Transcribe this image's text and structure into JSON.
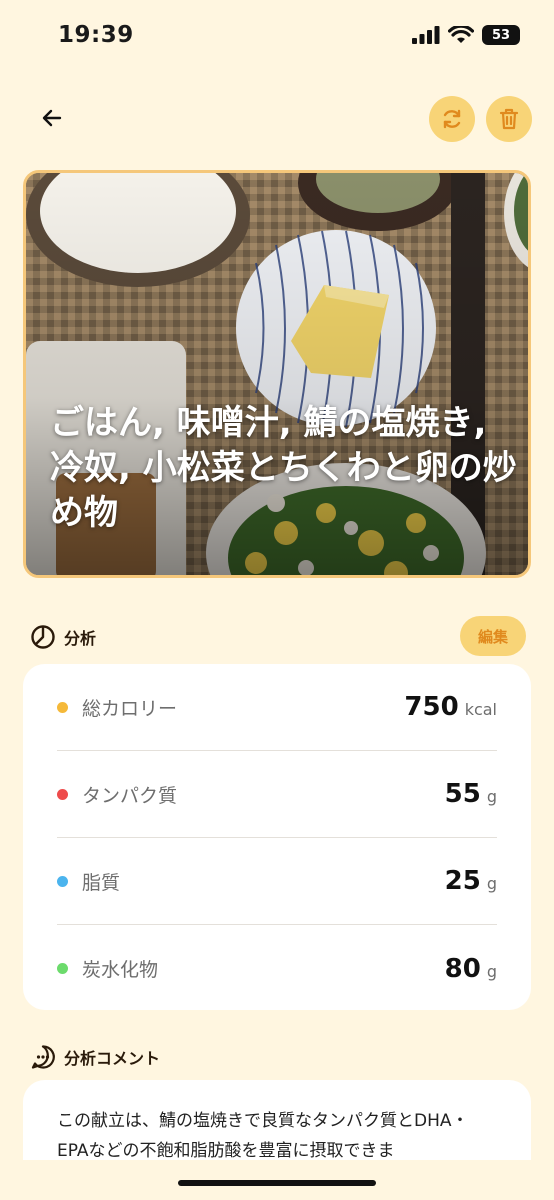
{
  "status_bar": {
    "time": "19:39",
    "battery": "53"
  },
  "header": {
    "back_icon": "arrow-left-icon",
    "regenerate_icon": "refresh-icon",
    "delete_icon": "trash-icon"
  },
  "meal": {
    "title": "ごはん, 味噌汁, 鯖の塩焼き, 冷奴, 小松菜とちくわと卵の炒め物"
  },
  "analysis": {
    "heading": "分析",
    "edit_label": "編集",
    "items": [
      {
        "label": "総カロリー",
        "value": "750",
        "unit": "kcal",
        "color": "#F5B93A"
      },
      {
        "label": "タンパク質",
        "value": "55",
        "unit": "g",
        "color": "#EE4B4B"
      },
      {
        "label": "脂質",
        "value": "25",
        "unit": "g",
        "color": "#4BB4EE"
      },
      {
        "label": "炭水化物",
        "value": "80",
        "unit": "g",
        "color": "#6CDB6C"
      }
    ]
  },
  "comment": {
    "heading": "分析コメント",
    "text": "この献立は、鯖の塩焼きで良質なタンパク質とDHA・EPAなどの不飽和脂肪酸を豊富に摂取できま"
  },
  "colors": {
    "background": "#FFF6E0",
    "accent": "#F8D477",
    "accent_text": "#E08A1E"
  }
}
